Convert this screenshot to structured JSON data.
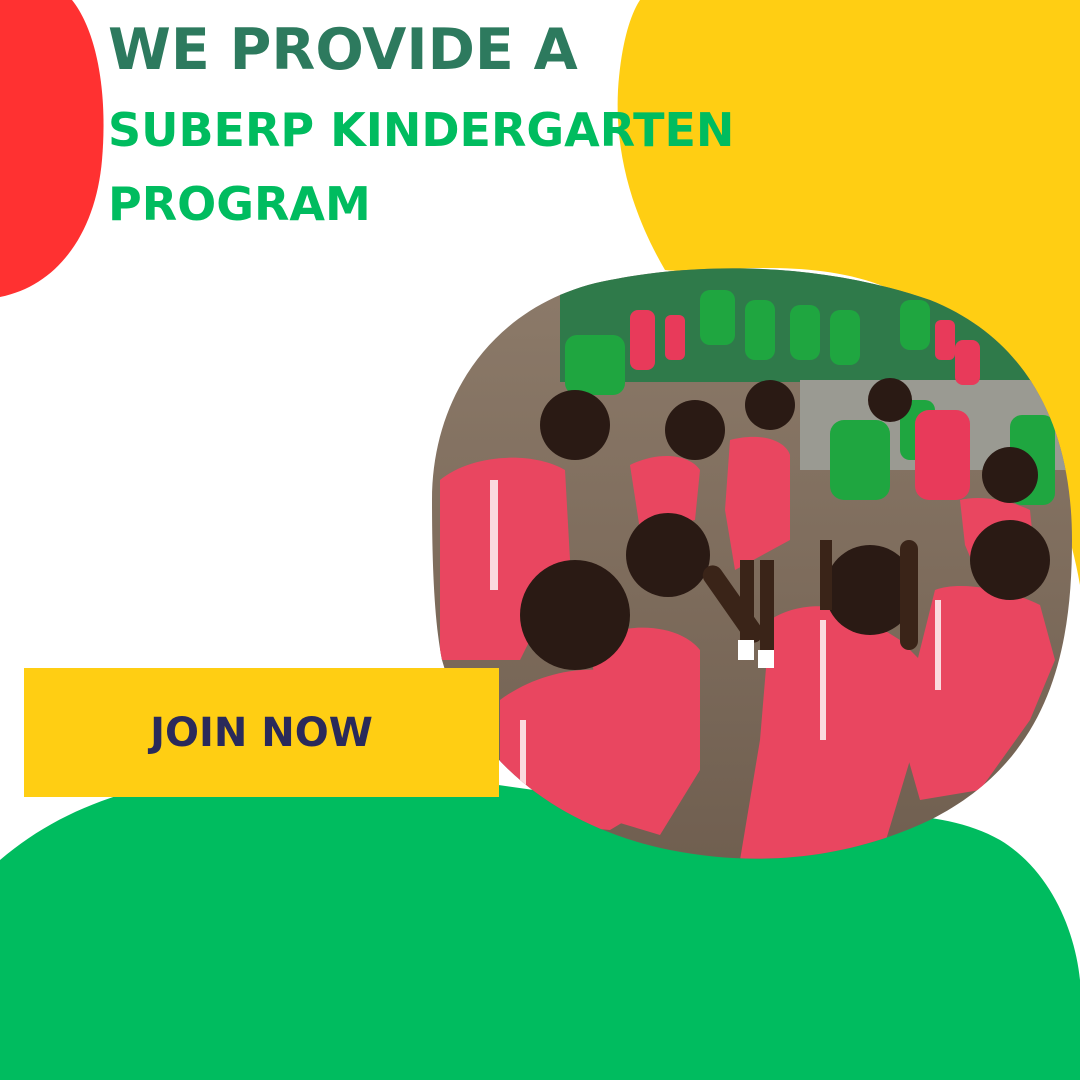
{
  "headline": {
    "line1": "WE PROVIDE A",
    "line2": "SUBERP KINDERGARTEN",
    "line3": "PROGRAM"
  },
  "cta": {
    "label": "JOIN NOW"
  },
  "photo": {
    "description_icon": "children-playground-photo"
  },
  "colors": {
    "red": "#FF3131",
    "yellow": "#FFCE13",
    "green": "#00BC5F",
    "headline_dark_green": "#2D7A5E",
    "headline_green": "#00BC5F",
    "cta_background": "#FFCE13",
    "cta_text": "#2A2A5A",
    "background": "#FFFFFF"
  }
}
